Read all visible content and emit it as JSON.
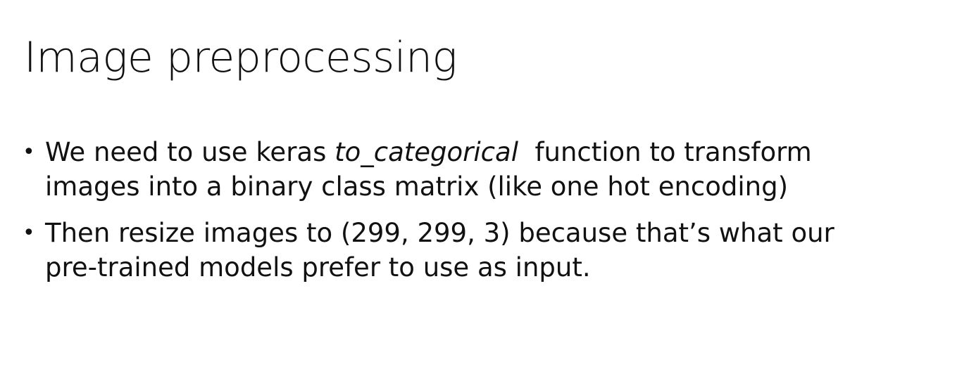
{
  "slide": {
    "title": "Image preprocessing",
    "bullets": [
      {
        "line1_before": "We need to use keras ",
        "line1_italic": "to_categorical",
        "line1_after": "  function to transform",
        "line2": "images into a binary class matrix (like one hot encoding)"
      },
      {
        "line1": "Then resize images to (299, 299, 3) because that’s what our",
        "line2": "pre-trained models prefer to use as input."
      }
    ],
    "bullet_glyph": "•"
  }
}
